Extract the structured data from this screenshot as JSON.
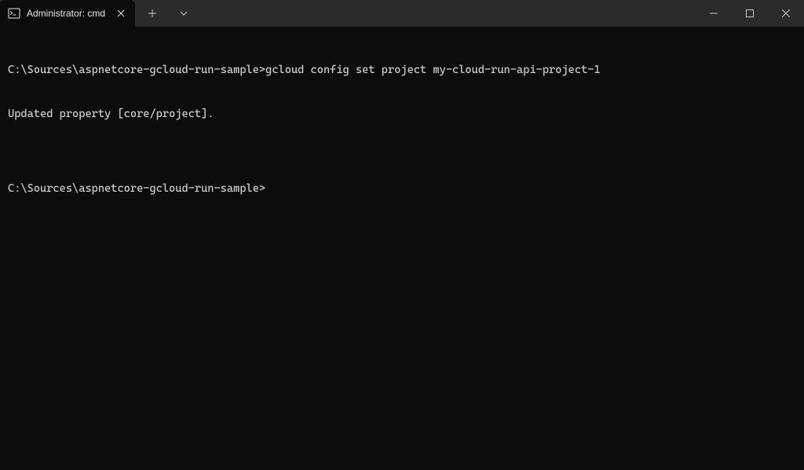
{
  "titlebar": {
    "tab_title": "Administrator: cmd"
  },
  "terminal": {
    "lines": [
      "C:\\Sources\\aspnetcore-gcloud-run-sample>gcloud config set project my-cloud-run-api-project-1",
      "Updated property [core/project].",
      "",
      "C:\\Sources\\aspnetcore-gcloud-run-sample>"
    ]
  }
}
